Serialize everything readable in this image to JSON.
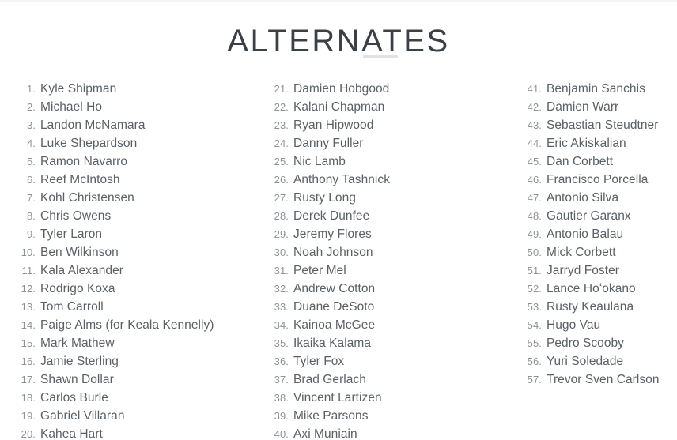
{
  "page": {
    "title": "ALTERNATES",
    "divider": "horizontal-rule",
    "text_color": "#5a6066",
    "number_color": "#8d9298",
    "title_color": "#3a4046",
    "divider_color": "#e2e2e2",
    "background_color": "#ffffff"
  },
  "columns": [
    {
      "name": "column-1",
      "items": [
        {
          "number": "1.",
          "name": "Kyle Shipman"
        },
        {
          "number": "2.",
          "name": "Michael Ho"
        },
        {
          "number": "3.",
          "name": "Landon McNamara"
        },
        {
          "number": "4.",
          "name": "Luke Shepardson"
        },
        {
          "number": "5.",
          "name": "Ramon Navarro"
        },
        {
          "number": "6.",
          "name": "Reef McIntosh"
        },
        {
          "number": "7.",
          "name": "Kohl Christensen"
        },
        {
          "number": "8.",
          "name": "Chris Owens"
        },
        {
          "number": "9.",
          "name": "Tyler Laron"
        },
        {
          "number": "10.",
          "name": "Ben Wilkinson"
        },
        {
          "number": "11.",
          "name": "Kala Alexander"
        },
        {
          "number": "12.",
          "name": "Rodrigo Koxa"
        },
        {
          "number": "13.",
          "name": "Tom Carroll"
        },
        {
          "number": "14.",
          "name": "Paige Alms (for Keala Kennelly)"
        },
        {
          "number": "15.",
          "name": "Mark Mathew"
        },
        {
          "number": "16.",
          "name": "Jamie Sterling"
        },
        {
          "number": "17.",
          "name": "Shawn Dollar"
        },
        {
          "number": "18.",
          "name": "Carlos Burle"
        },
        {
          "number": "19.",
          "name": "Gabriel Villaran"
        },
        {
          "number": "20.",
          "name": "Kahea Hart"
        }
      ]
    },
    {
      "name": "column-2",
      "items": [
        {
          "number": "21.",
          "name": "Damien Hobgood"
        },
        {
          "number": "22.",
          "name": "Kalani Chapman"
        },
        {
          "number": "23.",
          "name": "Ryan Hipwood"
        },
        {
          "number": "24.",
          "name": "Danny Fuller"
        },
        {
          "number": "25.",
          "name": "Nic Lamb"
        },
        {
          "number": "26.",
          "name": "Anthony Tashnick"
        },
        {
          "number": "27.",
          "name": "Rusty Long"
        },
        {
          "number": "28.",
          "name": "Derek Dunfee"
        },
        {
          "number": "29.",
          "name": "Jeremy Flores"
        },
        {
          "number": "30.",
          "name": "Noah Johnson"
        },
        {
          "number": "31.",
          "name": "Peter Mel"
        },
        {
          "number": "32.",
          "name": "Andrew Cotton"
        },
        {
          "number": "33.",
          "name": "Duane DeSoto"
        },
        {
          "number": "34.",
          "name": "Kainoa McGee"
        },
        {
          "number": "35.",
          "name": "Ikaika Kalama"
        },
        {
          "number": "36.",
          "name": "Tyler Fox"
        },
        {
          "number": "37.",
          "name": "Brad Gerlach"
        },
        {
          "number": "38.",
          "name": "Vincent Lartizen"
        },
        {
          "number": "39.",
          "name": "Mike Parsons"
        },
        {
          "number": "40.",
          "name": "Axi Muniain"
        }
      ]
    },
    {
      "name": "column-3",
      "items": [
        {
          "number": "41.",
          "name": "Benjamin Sanchis"
        },
        {
          "number": "42.",
          "name": "Damien Warr"
        },
        {
          "number": "43.",
          "name": "Sebastian Steudtner"
        },
        {
          "number": "44.",
          "name": "Eric Akiskalian"
        },
        {
          "number": "45.",
          "name": "Dan Corbett"
        },
        {
          "number": "46.",
          "name": "Francisco Porcella"
        },
        {
          "number": "47.",
          "name": "Antonio Silva"
        },
        {
          "number": "48.",
          "name": "Gautier Garanx"
        },
        {
          "number": "49.",
          "name": "Antonio Balau"
        },
        {
          "number": "50.",
          "name": "Mick Corbett"
        },
        {
          "number": "51.",
          "name": "Jarryd Foster"
        },
        {
          "number": "52.",
          "name": "Lance Hoʻokano"
        },
        {
          "number": "53.",
          "name": "Rusty Keaulana"
        },
        {
          "number": "54.",
          "name": "Hugo Vau"
        },
        {
          "number": "55.",
          "name": "Pedro Scooby"
        },
        {
          "number": "56.",
          "name": "Yuri Soledade"
        },
        {
          "number": "57.",
          "name": "Trevor Sven Carlson"
        }
      ]
    }
  ]
}
